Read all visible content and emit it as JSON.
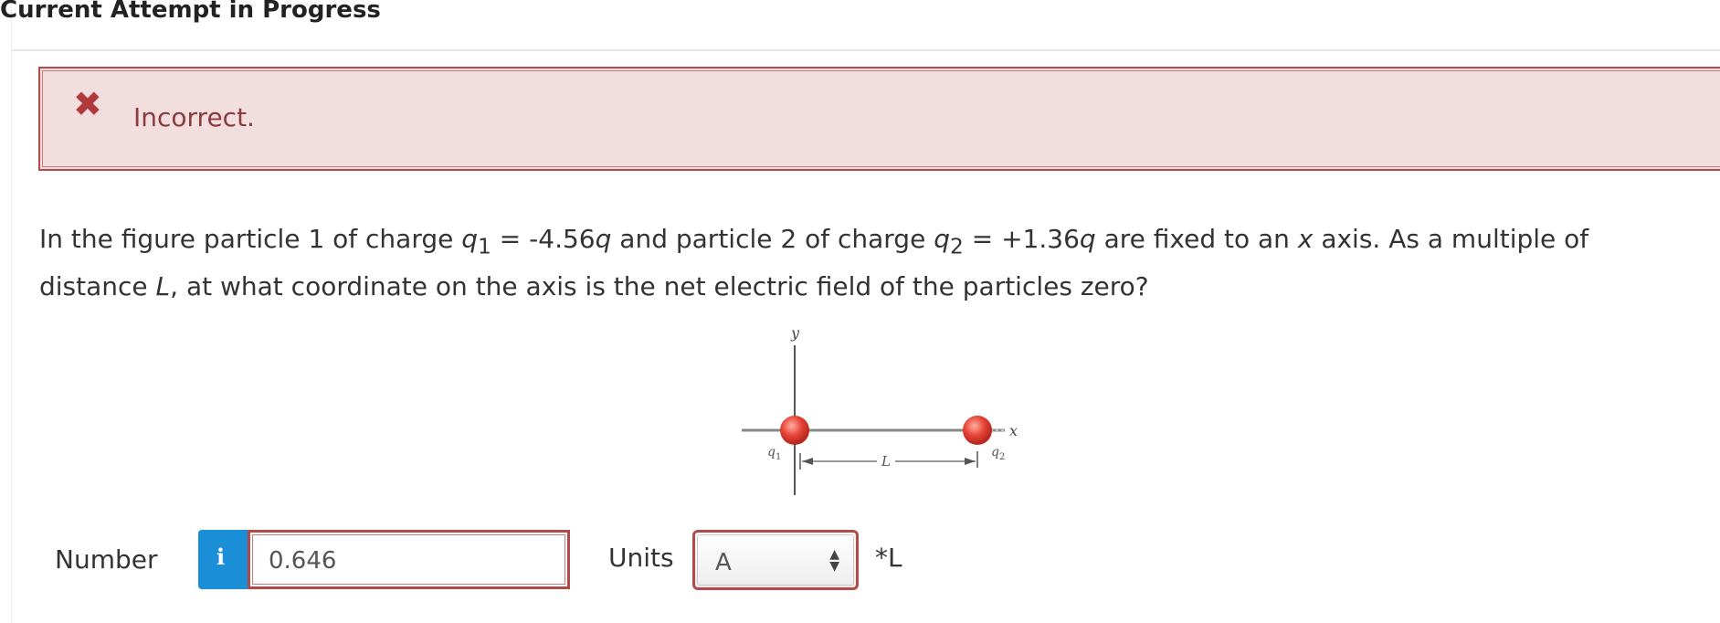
{
  "header": {
    "title": "Current Attempt in Progress"
  },
  "alert": {
    "icon": "close-x-icon",
    "text": "Incorrect."
  },
  "question": {
    "part1": "In the figure particle 1 of charge ",
    "q1_symbol": "q",
    "q1_sub": "1",
    "part2": " = -4.56",
    "q1_unit": "q",
    "part3": " and particle 2 of charge ",
    "q2_symbol": "q",
    "q2_sub": "2",
    "part4": " = +1.36",
    "q2_unit": "q",
    "part5": " are fixed to an ",
    "x_axis": "x",
    "part6": " axis. As a multiple of distance ",
    "L": "L",
    "part7": ", at what coordinate on the axis is the net electric field of the particles zero?"
  },
  "figure": {
    "y_label": "y",
    "x_label": "x",
    "q1_label": "q",
    "q1_sub": "1",
    "q2_label": "q",
    "q2_sub": "2",
    "distance_label": "L",
    "particle_color": "#e8463a"
  },
  "answer": {
    "number_label": "Number",
    "info_icon": "i",
    "number_value": "0.646",
    "units_label": "Units",
    "units_value": "A",
    "units_suffix": "*L"
  },
  "colors": {
    "alert_border": "#b34a4a",
    "alert_background": "#f2dede",
    "info_blue": "#1a8fd8"
  }
}
